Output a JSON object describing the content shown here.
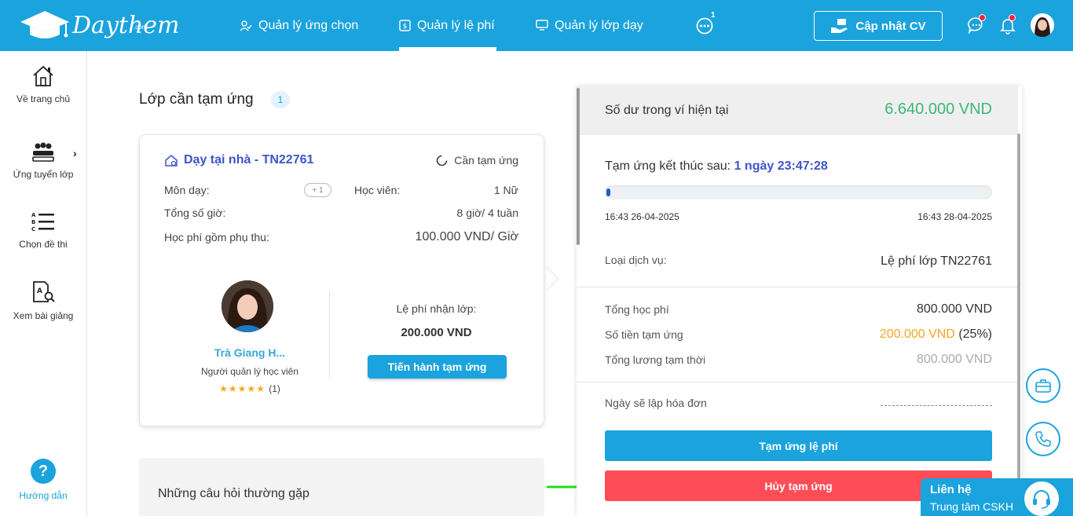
{
  "header": {
    "logo_text": "Daythem",
    "logo_suffix": ".com",
    "nav": [
      {
        "label": "Quản lý ứng chọn"
      },
      {
        "label": "Quản lý lệ phí"
      },
      {
        "label": "Quản lý lớp dạy"
      }
    ],
    "more_badge": "1",
    "cv_button": "Cập nhật CV"
  },
  "sidebar": {
    "items": [
      {
        "label": "Về trang chủ"
      },
      {
        "label": "Ứng tuyển lớp"
      },
      {
        "label": "Chọn đề thi"
      },
      {
        "label": "Xem bài giảng"
      }
    ],
    "help_symbol": "?",
    "help_label": "Hướng dẫn"
  },
  "main": {
    "title": "Lớp cần tạm ứng",
    "count": "1",
    "card": {
      "title": "Dạy tại nhà - TN22761",
      "status": "Cần tạm ứng",
      "subject_label": "Môn dạy:",
      "subject_more": "+ 1",
      "student_label": "Học viên:",
      "student_value": "1 Nữ",
      "hours_label": "Tổng số giờ:",
      "hours_value": "8 giờ/ 4 tuần",
      "fee_label": "Học phí gồm phụ thu:",
      "fee_value": "100.000 VND/ Giờ",
      "manager_name": "Trà Giang H...",
      "manager_role": "Người quản lý học viên",
      "rating_count": "(1)",
      "rating_stars": 5,
      "accept_fee_label": "Lệ phí nhận lớp:",
      "accept_fee_value": "200.000 VND",
      "advance_button": "Tiến hành tạm ứng"
    },
    "faq_title": "Những câu hỏi thường gặp"
  },
  "wallet": {
    "balance_label": "Số dư trong ví hiện tại",
    "balance_value": "6.640.000 VND",
    "ends_label": "Tạm ứng kết thúc sau:",
    "ends_value": "1 ngày 23:47:28",
    "progress_fraction": 0.01,
    "start_time": "16:43 26-04-2025",
    "end_time": "16:43 28-04-2025",
    "service_label": "Loại dịch vụ:",
    "service_value": "Lệ phí lớp TN22761",
    "total_fee_label": "Tổng học phí",
    "total_fee_value": "800.000 VND",
    "advance_amount_label": "Số tiền tạm ứng",
    "advance_amount_value": "200.000 VND",
    "advance_percent": "(25%)",
    "temp_salary_label": "Tổng lương tạm thời",
    "temp_salary_value": "800.000 VND",
    "invoice_label": "Ngày sẽ lập hóa đơn",
    "advance_fee_button": "Tạm ứng lệ phí",
    "cancel_button": "Hủy tạm ứng"
  },
  "contact": {
    "title": "Liên hệ",
    "subtitle": "Trung tâm CSKH"
  },
  "colors": {
    "brand": "#1aa3dd",
    "balance": "#3cb878",
    "cancel": "#ff4d58",
    "advance_amount": "#f5a623",
    "card_title": "#3d55c9"
  }
}
